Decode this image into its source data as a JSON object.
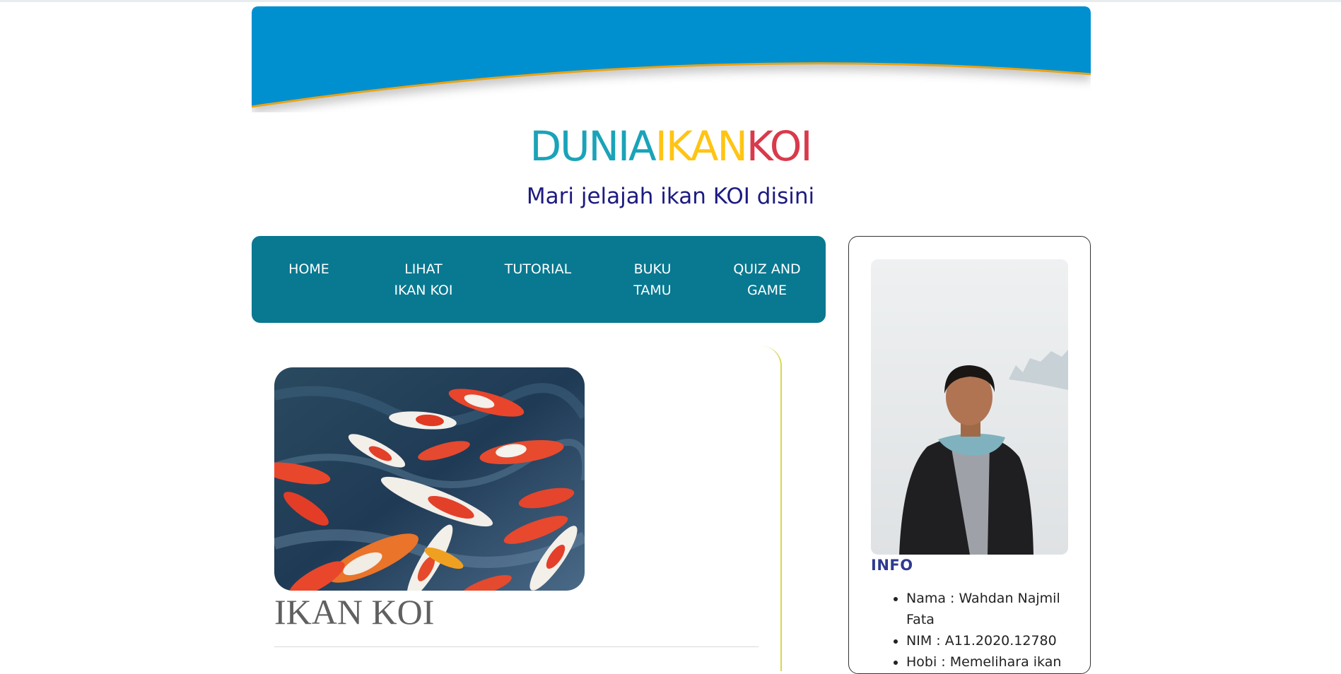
{
  "header": {
    "title_parts": [
      "DUNIA",
      "IKAN",
      "KOI"
    ],
    "subtitle": "Mari jelajah ikan KOI disini",
    "colors": {
      "dunia": "#1aa3b8",
      "ikan": "#ffc414",
      "koi": "#d93a4b",
      "banner": "#0090d0",
      "banner_curve": "#e8a317"
    }
  },
  "nav": {
    "color": "#087991",
    "items": [
      {
        "label_lines": [
          "HOME"
        ]
      },
      {
        "label_lines": [
          "LIHAT",
          "IKAN KOI"
        ]
      },
      {
        "label_lines": [
          "TUTORIAL"
        ]
      },
      {
        "label_lines": [
          "BUKU",
          "TAMU"
        ]
      },
      {
        "label_lines": [
          "QUIZ AND",
          "GAME"
        ]
      }
    ]
  },
  "content": {
    "heading": "IKAN KOI"
  },
  "sidebar": {
    "info_heading": "INFO",
    "info_items": [
      "Nama : Wahdan Najmil Fata",
      "NIM : A11.2020.12780",
      "Hobi : Memelihara ikan"
    ]
  }
}
